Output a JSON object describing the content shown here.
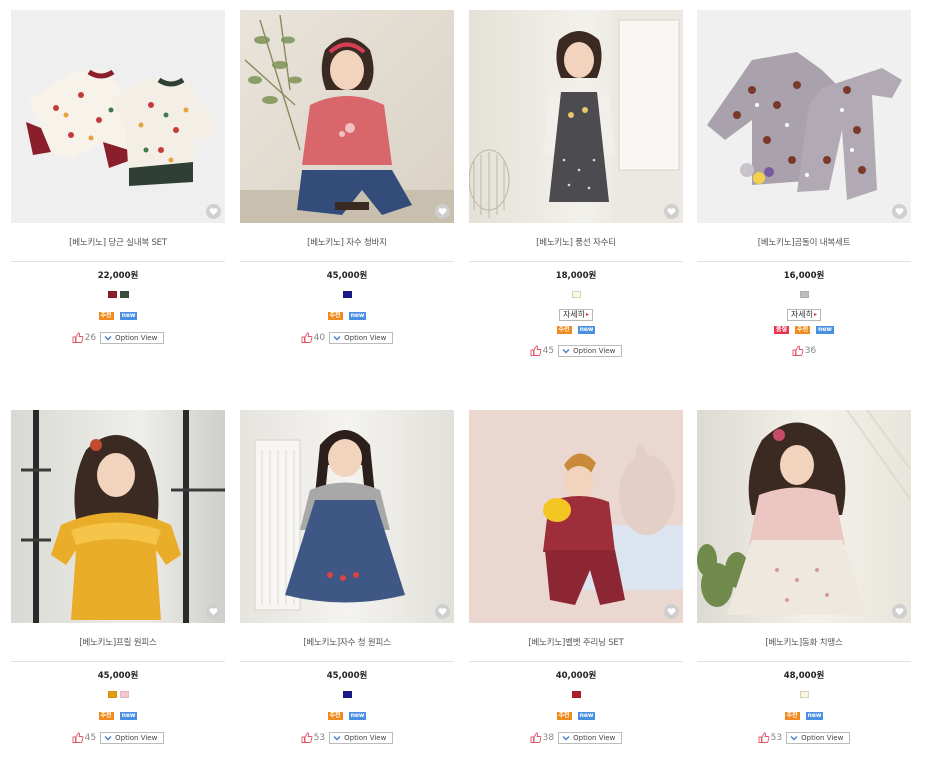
{
  "products": [
    {
      "name": "[베노키노] 당근 실내복 SET",
      "price": "22,000원",
      "colors": [
        "#8b1e2b",
        "#3c4f3f"
      ],
      "detail": null,
      "badges": [
        "rec",
        "new"
      ],
      "likes": "26",
      "option_view": "Option View",
      "image": "product-photo"
    },
    {
      "name": "[베노키노] 자수 청바지",
      "price": "45,000원",
      "colors": [
        "#1a1a8c"
      ],
      "detail": null,
      "badges": [
        "rec",
        "new"
      ],
      "likes": "40",
      "option_view": "Option View",
      "image": "product-photo"
    },
    {
      "name": "[베노키노] 풍선 자수티",
      "price": "18,000원",
      "colors": [
        "#fbf6e4"
      ],
      "detail": "자세히",
      "badges": [
        "rec",
        "new"
      ],
      "likes": "45",
      "option_view": "Option View",
      "image": "product-photo"
    },
    {
      "name": "[베노키노]곰돌이 내복세트",
      "price": "16,000원",
      "colors": [
        "#bdbdbd"
      ],
      "detail": "자세히",
      "badges": [
        "sale",
        "rec",
        "new"
      ],
      "likes": "36",
      "option_view": null,
      "image": "product-photo"
    },
    {
      "name": "[베노키노]프릴 원피스",
      "price": "45,000원",
      "colors": [
        "#e39b12",
        "#f5c6cf"
      ],
      "detail": null,
      "badges": [
        "rec",
        "new"
      ],
      "likes": "45",
      "option_view": "Option View",
      "image": "product-photo"
    },
    {
      "name": "[베노키노]자수 청 원피스",
      "price": "45,000원",
      "colors": [
        "#1a1a8c"
      ],
      "detail": null,
      "badges": [
        "rec",
        "new"
      ],
      "likes": "53",
      "option_view": "Option View",
      "image": "product-photo"
    },
    {
      "name": "[베노키노]벨벳 주리닝 SET",
      "price": "40,000원",
      "colors": [
        "#b01e2b"
      ],
      "detail": null,
      "badges": [
        "rec",
        "new"
      ],
      "likes": "38",
      "option_view": "Option View",
      "image": "product-photo"
    },
    {
      "name": "[베노키노]동화 치맹스",
      "price": "48,000원",
      "colors": [
        "#fbf6e4"
      ],
      "detail": null,
      "badges": [
        "rec",
        "new"
      ],
      "likes": "53",
      "option_view": "Option View",
      "image": "product-photo"
    }
  ],
  "badge_labels": {
    "sale": "품절",
    "rec": "추천",
    "new": "new"
  },
  "accent_colors": {
    "sale": "#e8344e",
    "rec": "#f08a1c",
    "new": "#4a90e2",
    "like": "#e05566"
  },
  "icons": [
    "heart-icon",
    "thumbs-up-icon",
    "chevron-down-icon"
  ]
}
